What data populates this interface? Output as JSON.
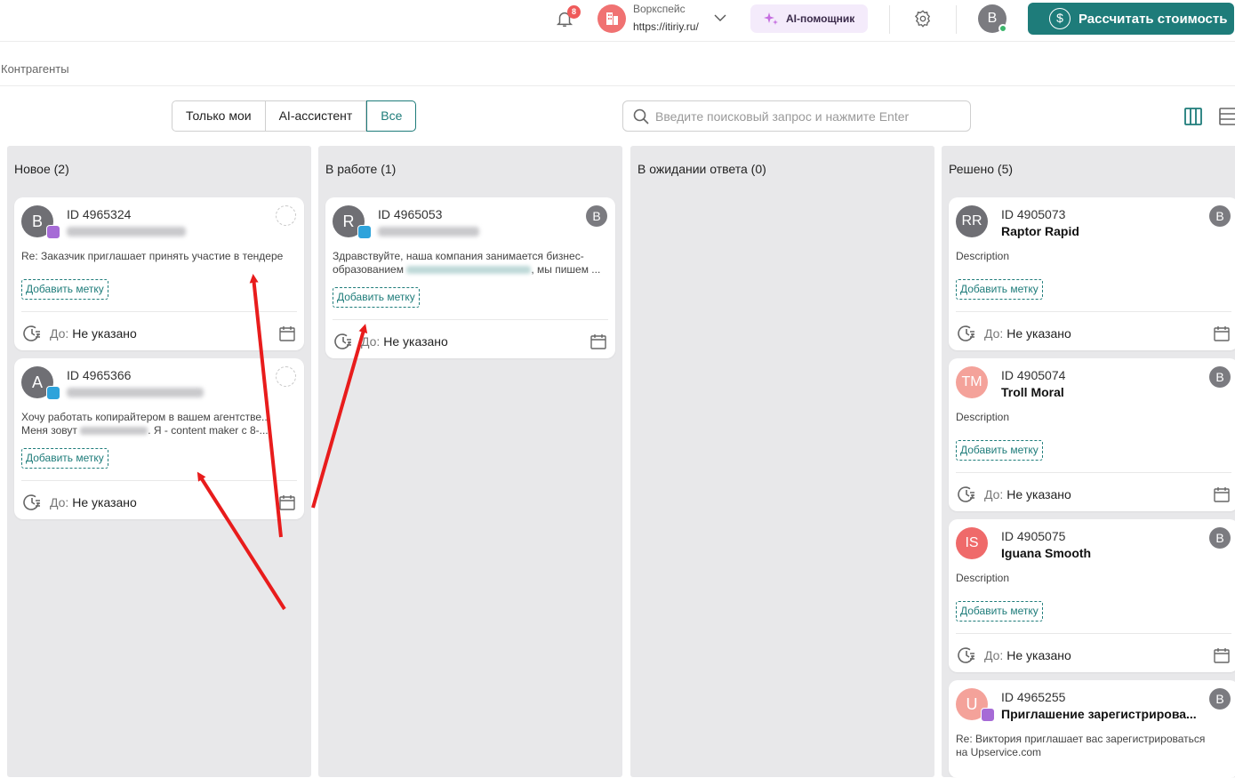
{
  "topbar": {
    "notifications_count": "8",
    "workspace_label": "Воркспейс",
    "workspace_url": "https://itiriy.ru/",
    "ai_button": "AI-помощник",
    "user_initial": "B",
    "calc_button": "Рассчитать стоимость"
  },
  "page": {
    "breadcrumb": "Контрагенты"
  },
  "filters": [
    "Только мои",
    "AI-ассистент",
    "Все"
  ],
  "search": {
    "placeholder": "Введите поисковый запрос и нажмите Enter"
  },
  "columns": [
    {
      "title": "Новое (2)"
    },
    {
      "title": "В работе (1)"
    },
    {
      "title": "В ожидании ответа (0)"
    },
    {
      "title": "Решено (5)"
    }
  ],
  "cards": {
    "due_label": "До:",
    "due_value": "Не указано",
    "tag_label": "Добавить метку",
    "new": [
      {
        "initial": "B",
        "id": "ID 4965324",
        "desc": "Re: Заказчик приглашает принять участие в тендере"
      },
      {
        "initial": "A",
        "id": "ID 4965366",
        "desc_line1": "Хочу работать копирайтером в вашем агентстве...",
        "desc_line2_pre": "Меня зовут",
        "desc_line2_post": ". Я - content maker с 8-..."
      }
    ],
    "in_progress": [
      {
        "initial": "R",
        "id": "ID 4965053",
        "resp": "B",
        "desc_line1": "Здравствуйте, наша компания занимается бизнес-",
        "desc_line2_pre": "образованием",
        "desc_line2_post": ", мы пишем ..."
      }
    ],
    "resolved": [
      {
        "initial": "RR",
        "id": "ID 4905073",
        "name": "Raptor Rapid",
        "resp": "B",
        "desc": "Description",
        "color": "#6f6f74"
      },
      {
        "initial": "TM",
        "id": "ID 4905074",
        "name": "Troll Moral",
        "resp": "B",
        "desc": "Description",
        "color": "#f4a29a"
      },
      {
        "initial": "IS",
        "id": "ID 4905075",
        "name": "Iguana Smooth",
        "resp": "B",
        "desc": "Description",
        "color": "#ef6a6a"
      },
      {
        "initial": "U",
        "id": "ID 4965255",
        "name": "Приглашение зарегистрирова...",
        "resp": "B",
        "desc_line1": "Re: Виктория приглашает вас зарегистрироваться",
        "desc_line2": "на Upservice.com",
        "color": "#f4a29a"
      }
    ]
  },
  "colors": {
    "accent": "#1e7c7a",
    "column_bg": "#e8e8ea",
    "annotation_arrow": "#e81c1c"
  }
}
